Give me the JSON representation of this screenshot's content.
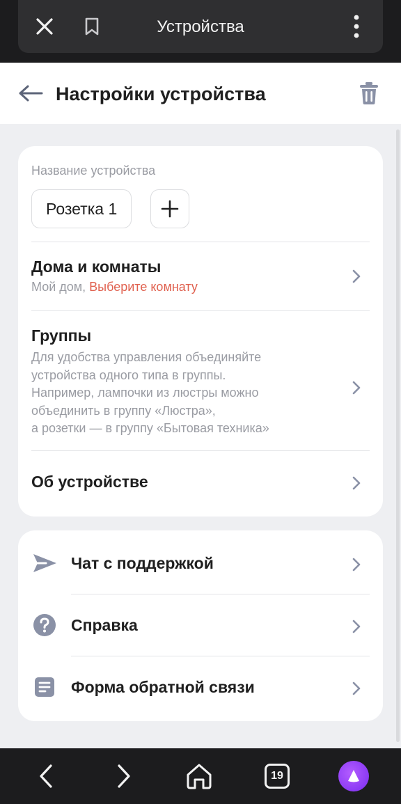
{
  "browser": {
    "title": "Устройства",
    "icons": [
      "close-icon",
      "bookmark-icon",
      "more-vertical-icon"
    ]
  },
  "header": {
    "title": "Настройки устройства",
    "icons": [
      "back-arrow-icon",
      "trash-icon"
    ]
  },
  "device_name": {
    "label": "Название устройства",
    "value": "Розетка 1",
    "add_icon": "plus-icon"
  },
  "settings": {
    "homes": {
      "title": "Дома и комнаты",
      "home": "Мой дом,",
      "room_prompt": "Выберите комнату"
    },
    "groups": {
      "title": "Группы",
      "description_lines": [
        "Для удобства управления объединяйте",
        "устройства одного типа в группы.",
        "Например, лампочки из люстры можно",
        "объединить в группу «Люстра»,",
        "а розетки — в группу «Бытовая техника»"
      ]
    },
    "about": {
      "title": "Об устройстве"
    }
  },
  "support": {
    "items": [
      {
        "label": "Чат с поддержкой",
        "icon": "send-icon"
      },
      {
        "label": "Справка",
        "icon": "help-icon"
      },
      {
        "label": "Форма обратной связи",
        "icon": "form-icon"
      }
    ]
  },
  "bottom_nav": {
    "tabs_count": "19",
    "icons": [
      "back-icon",
      "forward-icon",
      "home-icon",
      "tabs-icon",
      "alice-icon"
    ]
  },
  "colors": {
    "accent_red": "#e0614f",
    "icon_gray": "#8a91a6",
    "alice_purple": "#8b3cf7"
  }
}
